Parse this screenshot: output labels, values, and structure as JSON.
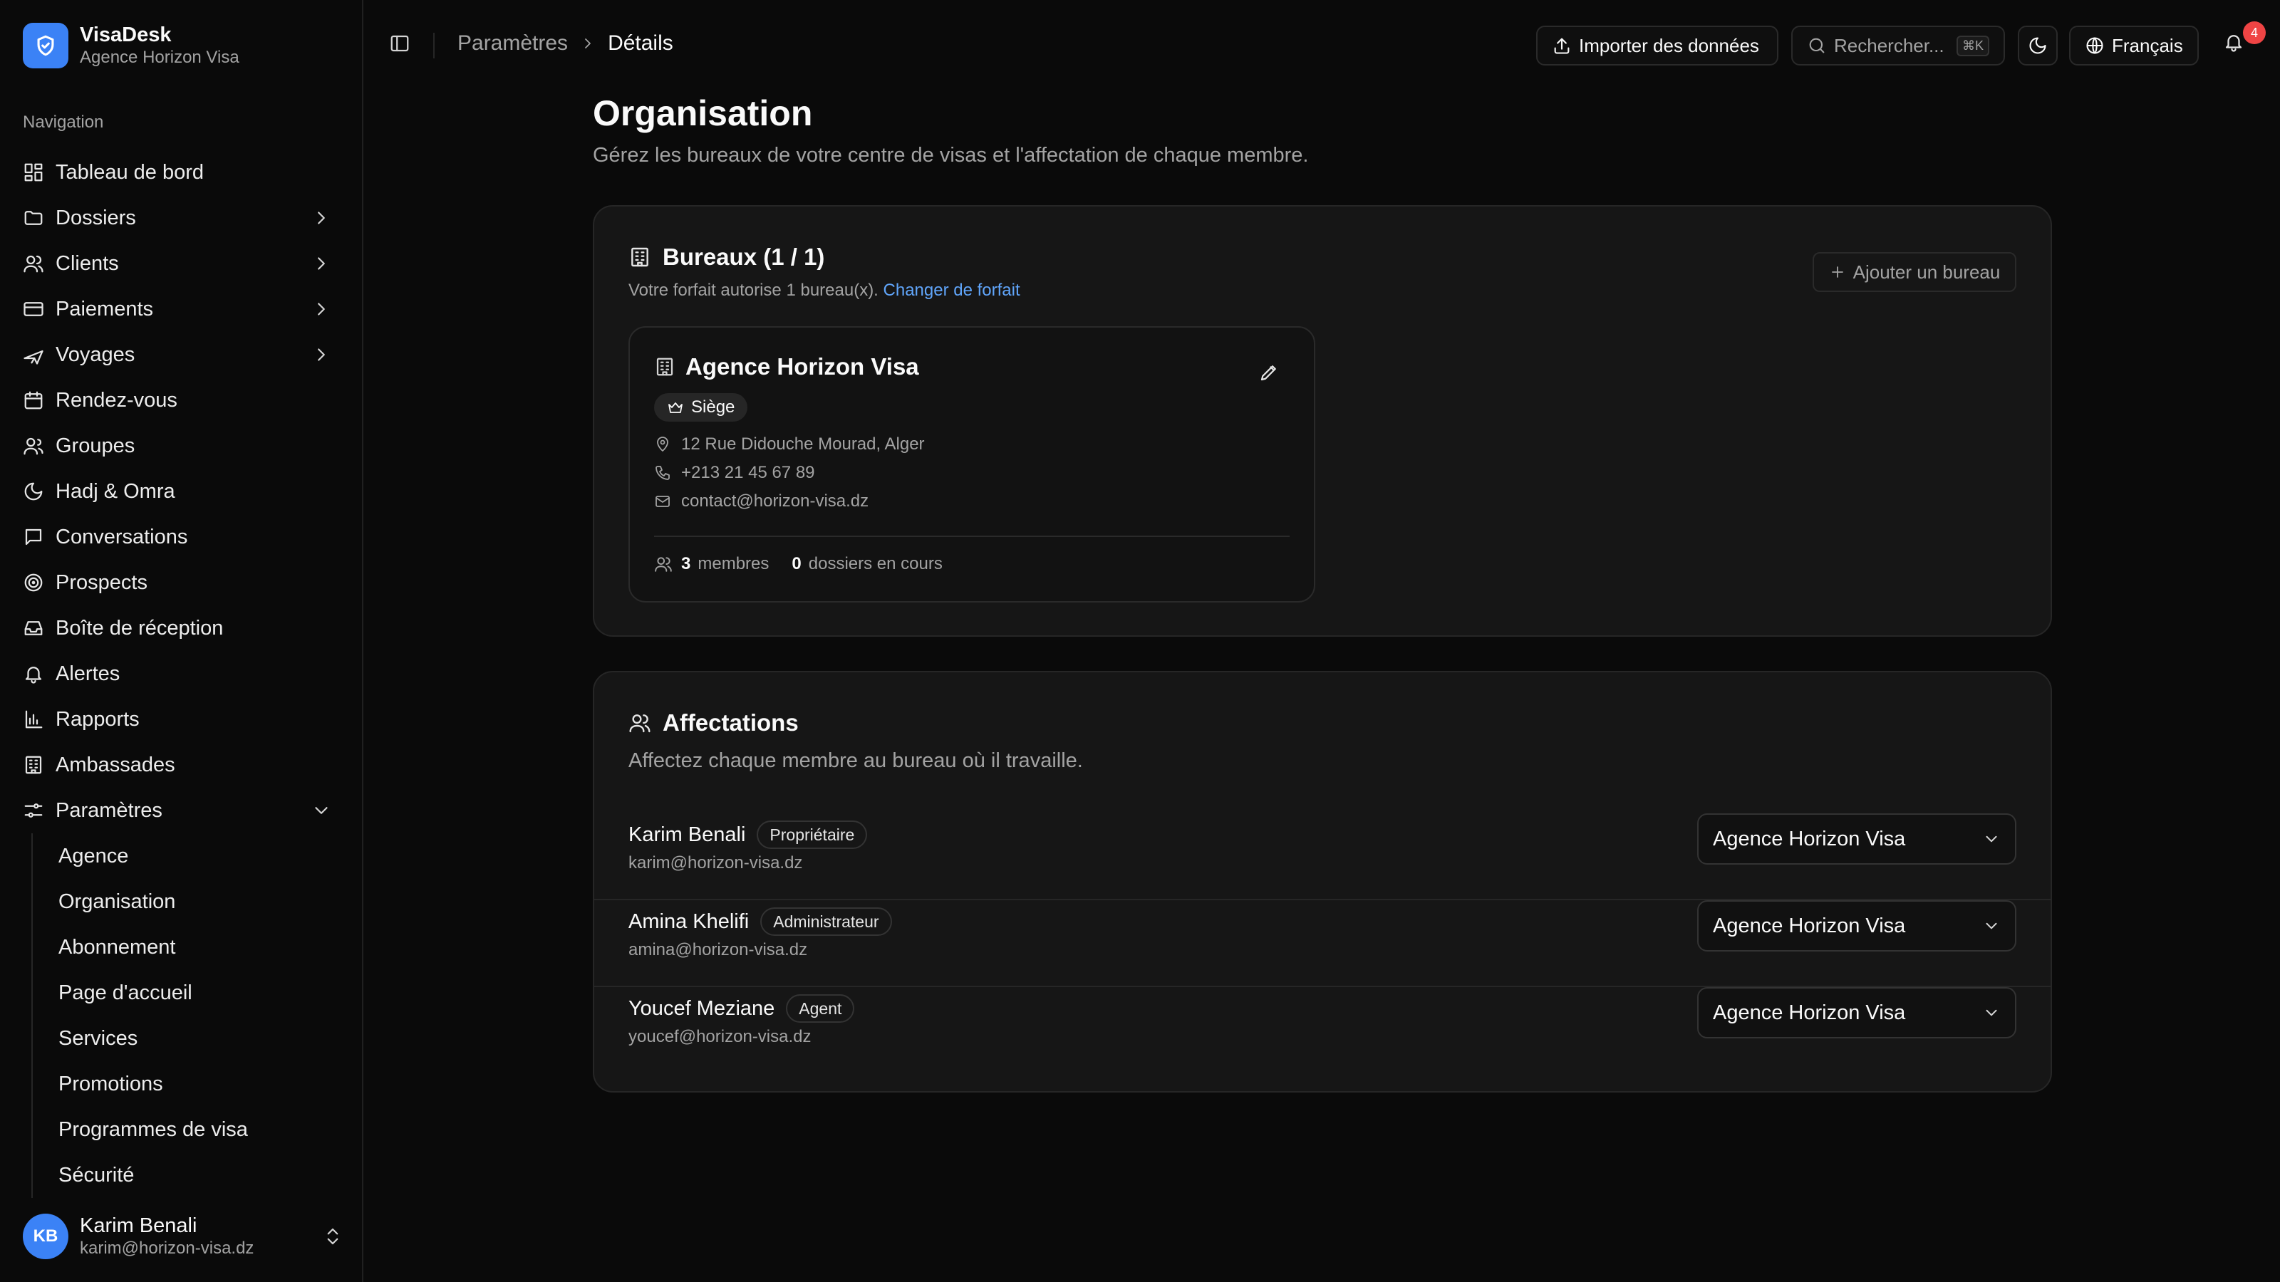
{
  "brand": {
    "name": "VisaDesk",
    "subtitle": "Agence Horizon Visa",
    "accent": "#3b82f6"
  },
  "sidebar": {
    "section_label": "Navigation",
    "items": [
      {
        "label": "Tableau de bord",
        "icon": "dashboard-icon",
        "has_chevron": false
      },
      {
        "label": "Dossiers",
        "icon": "folder-icon",
        "has_chevron": true
      },
      {
        "label": "Clients",
        "icon": "users-icon",
        "has_chevron": true
      },
      {
        "label": "Paiements",
        "icon": "credit-card-icon",
        "has_chevron": true
      },
      {
        "label": "Voyages",
        "icon": "plane-icon",
        "has_chevron": true
      },
      {
        "label": "Rendez-vous",
        "icon": "calendar-icon",
        "has_chevron": false
      },
      {
        "label": "Groupes",
        "icon": "group-icon",
        "has_chevron": false
      },
      {
        "label": "Hadj & Omra",
        "icon": "moon-icon",
        "has_chevron": false
      },
      {
        "label": "Conversations",
        "icon": "message-icon",
        "has_chevron": false
      },
      {
        "label": "Prospects",
        "icon": "target-icon",
        "has_chevron": false
      },
      {
        "label": "Boîte de réception",
        "icon": "inbox-icon",
        "has_chevron": false
      },
      {
        "label": "Alertes",
        "icon": "bell-icon",
        "has_chevron": false
      },
      {
        "label": "Rapports",
        "icon": "bar-chart-icon",
        "has_chevron": false
      },
      {
        "label": "Ambassades",
        "icon": "building-icon",
        "has_chevron": false
      },
      {
        "label": "Paramètres",
        "icon": "settings-sliders-icon",
        "has_chevron": true,
        "expanded": true
      }
    ],
    "sub_items": [
      "Agence",
      "Organisation",
      "Abonnement",
      "Page d'accueil",
      "Services",
      "Promotions",
      "Programmes de visa",
      "Sécurité"
    ],
    "user": {
      "initials": "KB",
      "name": "Karim Benali",
      "email": "karim@horizon-visa.dz"
    }
  },
  "topbar": {
    "breadcrumb": [
      "Paramètres",
      "Détails"
    ],
    "import_label": "Importer des données",
    "search_placeholder": "Rechercher...",
    "search_shortcut": "⌘K",
    "language": "Français",
    "notification_count": "4"
  },
  "page": {
    "title": "Organisation",
    "subtitle": "Gérez les bureaux de votre centre de visas et l'affectation de chaque membre."
  },
  "offices": {
    "title": "Bureaux (1 / 1)",
    "note": "Votre forfait autorise 1 bureau(x).",
    "note_link": "Changer de forfait",
    "add_button": "Ajouter un bureau",
    "office": {
      "name": "Agence Horizon Visa",
      "badge": "Siège",
      "address": "12 Rue Didouche Mourad, Alger",
      "phone": "+213 21 45 67 89",
      "email": "contact@horizon-visa.dz",
      "members_count": "3",
      "members_label": "membres",
      "files_count": "0",
      "files_label": "dossiers en cours"
    }
  },
  "assignments": {
    "title": "Affectations",
    "subtitle": "Affectez chaque membre au bureau où il travaille.",
    "members": [
      {
        "name": "Karim Benali",
        "role": "Propriétaire",
        "email": "karim@horizon-visa.dz",
        "office": "Agence Horizon Visa"
      },
      {
        "name": "Amina Khelifi",
        "role": "Administrateur",
        "email": "amina@horizon-visa.dz",
        "office": "Agence Horizon Visa"
      },
      {
        "name": "Youcef Meziane",
        "role": "Agent",
        "email": "youcef@horizon-visa.dz",
        "office": "Agence Horizon Visa"
      }
    ]
  }
}
